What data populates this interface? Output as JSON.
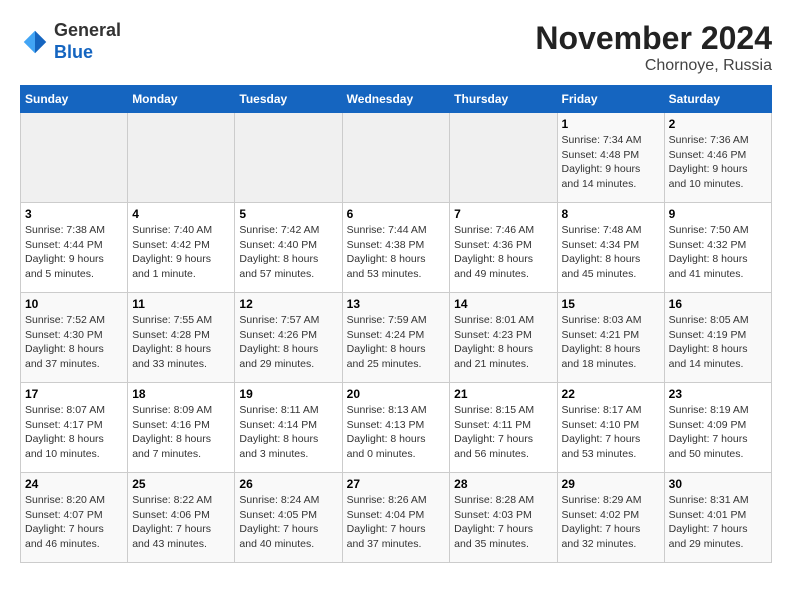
{
  "logo": {
    "general": "General",
    "blue": "Blue"
  },
  "title": "November 2024",
  "location": "Chornoye, Russia",
  "days_of_week": [
    "Sunday",
    "Monday",
    "Tuesday",
    "Wednesday",
    "Thursday",
    "Friday",
    "Saturday"
  ],
  "weeks": [
    [
      {
        "day": "",
        "info": ""
      },
      {
        "day": "",
        "info": ""
      },
      {
        "day": "",
        "info": ""
      },
      {
        "day": "",
        "info": ""
      },
      {
        "day": "",
        "info": ""
      },
      {
        "day": "1",
        "info": "Sunrise: 7:34 AM\nSunset: 4:48 PM\nDaylight: 9 hours and 14 minutes."
      },
      {
        "day": "2",
        "info": "Sunrise: 7:36 AM\nSunset: 4:46 PM\nDaylight: 9 hours and 10 minutes."
      }
    ],
    [
      {
        "day": "3",
        "info": "Sunrise: 7:38 AM\nSunset: 4:44 PM\nDaylight: 9 hours and 5 minutes."
      },
      {
        "day": "4",
        "info": "Sunrise: 7:40 AM\nSunset: 4:42 PM\nDaylight: 9 hours and 1 minute."
      },
      {
        "day": "5",
        "info": "Sunrise: 7:42 AM\nSunset: 4:40 PM\nDaylight: 8 hours and 57 minutes."
      },
      {
        "day": "6",
        "info": "Sunrise: 7:44 AM\nSunset: 4:38 PM\nDaylight: 8 hours and 53 minutes."
      },
      {
        "day": "7",
        "info": "Sunrise: 7:46 AM\nSunset: 4:36 PM\nDaylight: 8 hours and 49 minutes."
      },
      {
        "day": "8",
        "info": "Sunrise: 7:48 AM\nSunset: 4:34 PM\nDaylight: 8 hours and 45 minutes."
      },
      {
        "day": "9",
        "info": "Sunrise: 7:50 AM\nSunset: 4:32 PM\nDaylight: 8 hours and 41 minutes."
      }
    ],
    [
      {
        "day": "10",
        "info": "Sunrise: 7:52 AM\nSunset: 4:30 PM\nDaylight: 8 hours and 37 minutes."
      },
      {
        "day": "11",
        "info": "Sunrise: 7:55 AM\nSunset: 4:28 PM\nDaylight: 8 hours and 33 minutes."
      },
      {
        "day": "12",
        "info": "Sunrise: 7:57 AM\nSunset: 4:26 PM\nDaylight: 8 hours and 29 minutes."
      },
      {
        "day": "13",
        "info": "Sunrise: 7:59 AM\nSunset: 4:24 PM\nDaylight: 8 hours and 25 minutes."
      },
      {
        "day": "14",
        "info": "Sunrise: 8:01 AM\nSunset: 4:23 PM\nDaylight: 8 hours and 21 minutes."
      },
      {
        "day": "15",
        "info": "Sunrise: 8:03 AM\nSunset: 4:21 PM\nDaylight: 8 hours and 18 minutes."
      },
      {
        "day": "16",
        "info": "Sunrise: 8:05 AM\nSunset: 4:19 PM\nDaylight: 8 hours and 14 minutes."
      }
    ],
    [
      {
        "day": "17",
        "info": "Sunrise: 8:07 AM\nSunset: 4:17 PM\nDaylight: 8 hours and 10 minutes."
      },
      {
        "day": "18",
        "info": "Sunrise: 8:09 AM\nSunset: 4:16 PM\nDaylight: 8 hours and 7 minutes."
      },
      {
        "day": "19",
        "info": "Sunrise: 8:11 AM\nSunset: 4:14 PM\nDaylight: 8 hours and 3 minutes."
      },
      {
        "day": "20",
        "info": "Sunrise: 8:13 AM\nSunset: 4:13 PM\nDaylight: 8 hours and 0 minutes."
      },
      {
        "day": "21",
        "info": "Sunrise: 8:15 AM\nSunset: 4:11 PM\nDaylight: 7 hours and 56 minutes."
      },
      {
        "day": "22",
        "info": "Sunrise: 8:17 AM\nSunset: 4:10 PM\nDaylight: 7 hours and 53 minutes."
      },
      {
        "day": "23",
        "info": "Sunrise: 8:19 AM\nSunset: 4:09 PM\nDaylight: 7 hours and 50 minutes."
      }
    ],
    [
      {
        "day": "24",
        "info": "Sunrise: 8:20 AM\nSunset: 4:07 PM\nDaylight: 7 hours and 46 minutes."
      },
      {
        "day": "25",
        "info": "Sunrise: 8:22 AM\nSunset: 4:06 PM\nDaylight: 7 hours and 43 minutes."
      },
      {
        "day": "26",
        "info": "Sunrise: 8:24 AM\nSunset: 4:05 PM\nDaylight: 7 hours and 40 minutes."
      },
      {
        "day": "27",
        "info": "Sunrise: 8:26 AM\nSunset: 4:04 PM\nDaylight: 7 hours and 37 minutes."
      },
      {
        "day": "28",
        "info": "Sunrise: 8:28 AM\nSunset: 4:03 PM\nDaylight: 7 hours and 35 minutes."
      },
      {
        "day": "29",
        "info": "Sunrise: 8:29 AM\nSunset: 4:02 PM\nDaylight: 7 hours and 32 minutes."
      },
      {
        "day": "30",
        "info": "Sunrise: 8:31 AM\nSunset: 4:01 PM\nDaylight: 7 hours and 29 minutes."
      }
    ]
  ]
}
